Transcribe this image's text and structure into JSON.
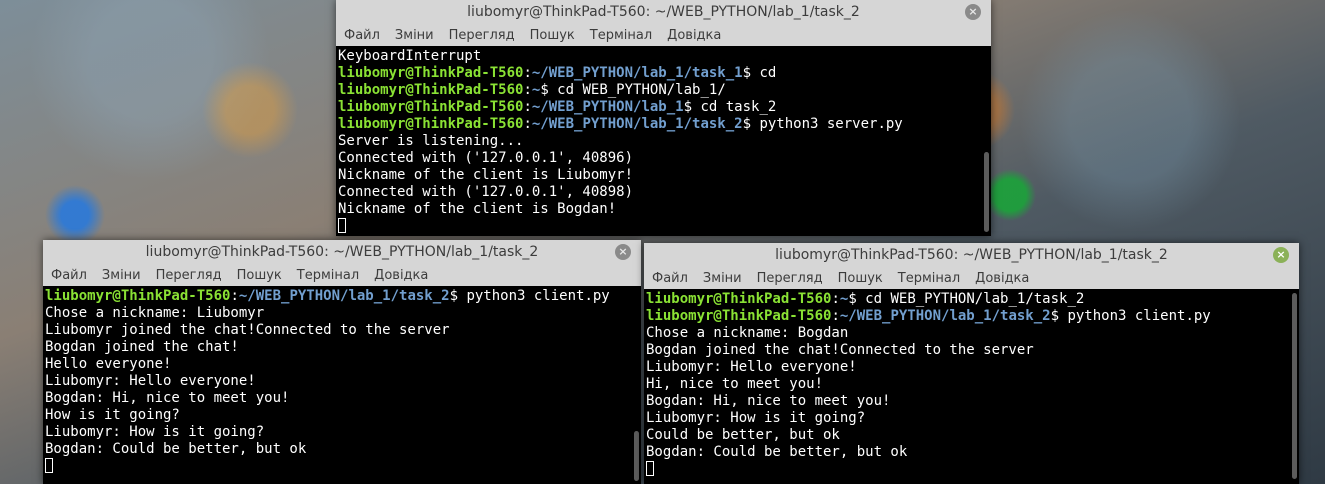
{
  "menu": [
    "Файл",
    "Зміни",
    "Перегляд",
    "Пошук",
    "Термінал",
    "Довідка"
  ],
  "windows": {
    "server": {
      "title": "liubomyr@ThinkPad-T560: ~/WEB_PYTHON/lab_1/task_2",
      "close_label": "×",
      "lines": [
        {
          "out": "KeyboardInterrupt"
        },
        {
          "user": "liubomyr@ThinkPad-T560",
          "sep": ":",
          "path": "~/WEB_PYTHON/lab_1/task_1",
          "cmd": "$ cd"
        },
        {
          "user": "liubomyr@ThinkPad-T560",
          "sep": ":",
          "path": "~",
          "cmd": "$ cd WEB_PYTHON/lab_1/"
        },
        {
          "user": "liubomyr@ThinkPad-T560",
          "sep": ":",
          "path": "~/WEB_PYTHON/lab_1",
          "cmd": "$ cd task_2"
        },
        {
          "user": "liubomyr@ThinkPad-T560",
          "sep": ":",
          "path": "~/WEB_PYTHON/lab_1/task_2",
          "cmd": "$ python3 server.py"
        },
        {
          "out": "Server is listening..."
        },
        {
          "out": "Connected with ('127.0.0.1', 40896)"
        },
        {
          "out": "Nickname of the client is Liubomyr!"
        },
        {
          "out": "Connected with ('127.0.0.1', 40898)"
        },
        {
          "out": "Nickname of the client is Bogdan!"
        },
        {
          "cursor": true
        }
      ]
    },
    "client1": {
      "title": "liubomyr@ThinkPad-T560: ~/WEB_PYTHON/lab_1/task_2",
      "close_label": "×",
      "lines": [
        {
          "user": "liubomyr@ThinkPad-T560",
          "sep": ":",
          "path": "~/WEB_PYTHON/lab_1/task_2",
          "cmd": "$ python3 client.py"
        },
        {
          "out": "Chose a nickname: Liubomyr"
        },
        {
          "out": "Liubomyr joined the chat!Connected to the server"
        },
        {
          "out": "Bogdan joined the chat!"
        },
        {
          "out": "Hello everyone!"
        },
        {
          "out": "Liubomyr: Hello everyone!"
        },
        {
          "out": "Bogdan: Hi, nice to meet you!"
        },
        {
          "out": "How is it going?"
        },
        {
          "out": "Liubomyr: How is it going?"
        },
        {
          "out": "Bogdan: Could be better, but ok"
        },
        {
          "cursor": true
        }
      ]
    },
    "client2": {
      "title": "liubomyr@ThinkPad-T560: ~/WEB_PYTHON/lab_1/task_2",
      "close_label": "×",
      "lines": [
        {
          "user": "liubomyr@ThinkPad-T560",
          "sep": ":",
          "path": "~",
          "cmd": "$ cd WEB_PYTHON/lab_1/task_2"
        },
        {
          "user": "liubomyr@ThinkPad-T560",
          "sep": ":",
          "path": "~/WEB_PYTHON/lab_1/task_2",
          "cmd": "$ python3 client.py"
        },
        {
          "out": "Chose a nickname: Bogdan"
        },
        {
          "out": "Bogdan joined the chat!Connected to the server"
        },
        {
          "out": "Liubomyr: Hello everyone!"
        },
        {
          "out": "Hi, nice to meet you!"
        },
        {
          "out": "Bogdan: Hi, nice to meet you!"
        },
        {
          "out": "Liubomyr: How is it going?"
        },
        {
          "out": "Could be better, but ok"
        },
        {
          "out": "Bogdan: Could be better, but ok"
        },
        {
          "cursor": true
        }
      ]
    }
  },
  "colors": {
    "prompt_user": "#8ae234",
    "prompt_path": "#729fcf",
    "terminal_bg": "#000000",
    "terminal_fg": "#ffffff",
    "chrome_bg": "#d6d6d6",
    "close_active": "#8bb158",
    "close_inactive": "#8a8a8a"
  }
}
